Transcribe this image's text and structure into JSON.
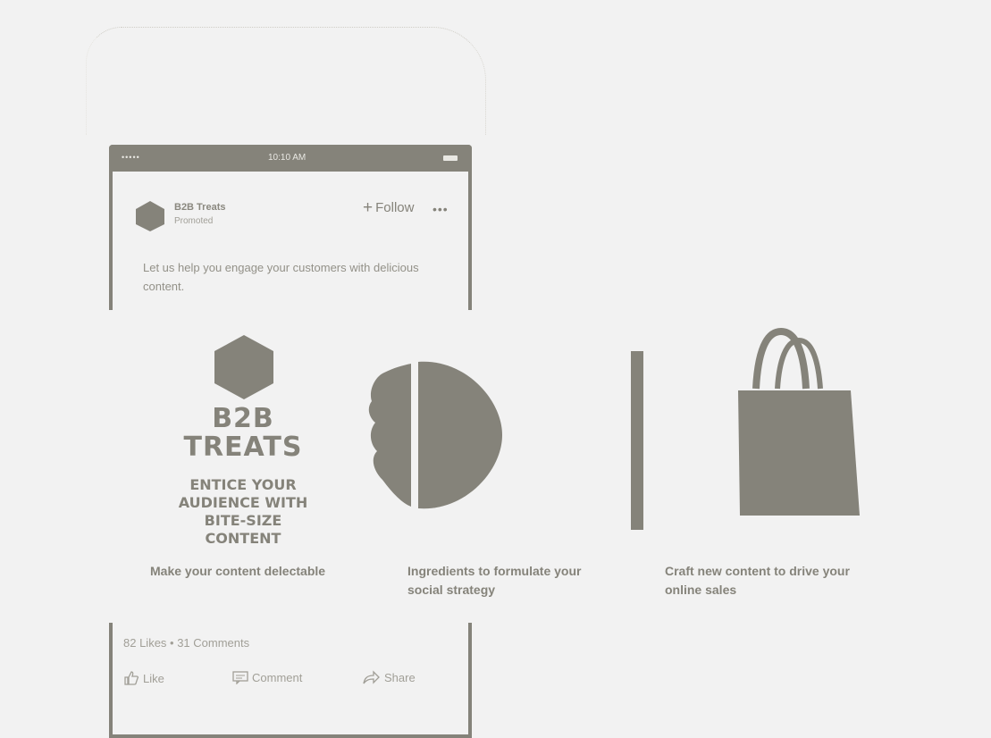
{
  "phone": {
    "status_dots": "•••••",
    "time": "10:10 AM"
  },
  "post": {
    "brand_name": "B2B Treats",
    "promoted_label": "Promoted",
    "follow_label": "Follow",
    "more_label": "•••",
    "text": "Let us help you engage your customers with delicious content."
  },
  "carousel": {
    "cards": [
      {
        "caption": "Make your content delectable",
        "logo_title": "B2B TREATS",
        "logo_tagline": "ENTICE YOUR AUDIENCE WITH BITE-SIZE CONTENT"
      },
      {
        "caption": "Ingredients to formulate your social strategy"
      },
      {
        "caption": "Craft new content to drive your online sales"
      }
    ]
  },
  "footer": {
    "counts": "82 Likes • 31 Comments",
    "like_label": "Like",
    "comment_label": "Comment",
    "share_label": "Share"
  },
  "colors": {
    "ink": "#85837a",
    "background": "#f2f2f2"
  }
}
